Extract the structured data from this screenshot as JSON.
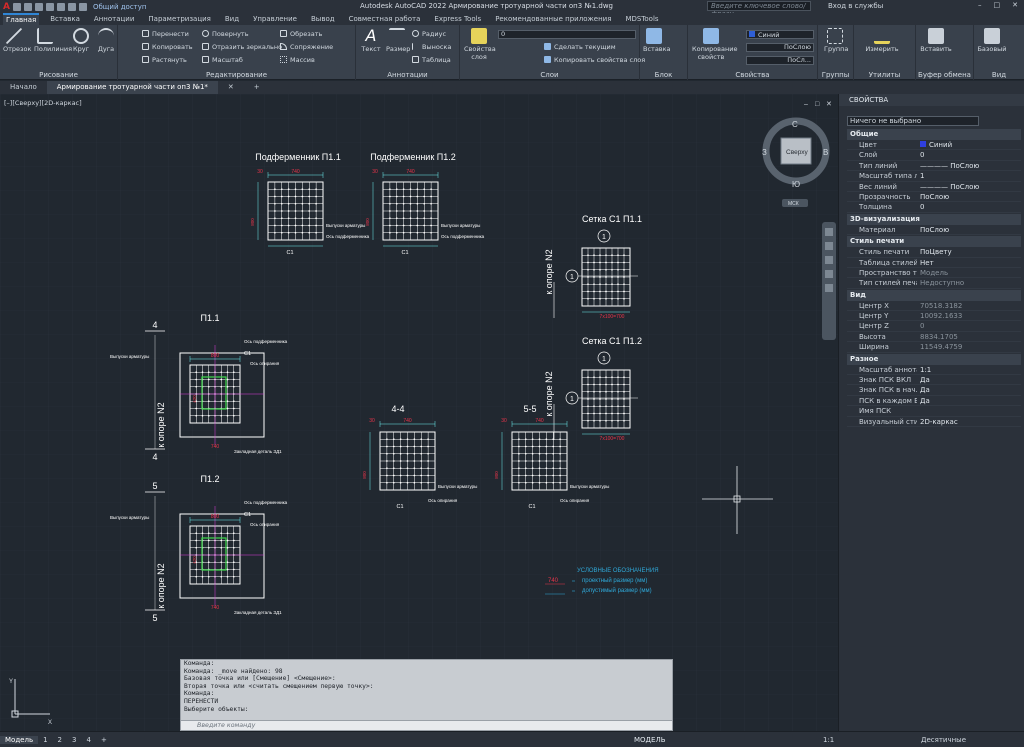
{
  "title": {
    "app_caption": "Autodesk AutoCAD 2022   Армирование тротуарной части оп3 №1.dwg",
    "share": "Общий доступ",
    "search_placeholder": "Введите ключевое слово/фразу",
    "login": "Вход в службы"
  },
  "ribbon_tabs": [
    "Главная",
    "Вставка",
    "Аннотации",
    "Параметризация",
    "Вид",
    "Управление",
    "Вывод",
    "Совместная работа",
    "Express Tools",
    "Рекомендованные приложения",
    "MDSTools"
  ],
  "ribbon": {
    "draw": {
      "title": "Рисование",
      "line": "Отрезок",
      "polyline": "Полилиния",
      "circle": "Круг",
      "arc": "Дуга"
    },
    "modify": {
      "title": "Редактирование",
      "move": "Перенести",
      "rotate": "Повернуть",
      "trim": "Обрезать",
      "copy": "Копировать",
      "mirror": "Отразить зеркально",
      "fillet": "Сопряжение",
      "stretch": "Растянуть",
      "scale": "Масштаб",
      "array": "Массив"
    },
    "annotation": {
      "title": "Аннотации",
      "text": "Текст",
      "dimension": "Размер",
      "radius": "Радиус",
      "leader": "Выноска",
      "table": "Таблица"
    },
    "layers": {
      "title": "Слои",
      "props": "Свойства слоя",
      "layer_value": "0",
      "make_current": "Сделать текущим",
      "match": "Копировать свойства слоя"
    },
    "block": {
      "title": "Блок",
      "insert": "Вставка"
    },
    "properties": {
      "title": "Свойства",
      "match": "Копирование свойств",
      "color": "Синий",
      "linetype": "ПоСлою",
      "lineweight": "ПоСл..."
    },
    "groups": {
      "title": "Группы",
      "group": "Группа"
    },
    "utilities": {
      "title": "Утилиты",
      "measure": "Измерить"
    },
    "clipboard": {
      "title": "Буфер обмена",
      "paste": "Вставить"
    },
    "view": {
      "title": "Вид",
      "base": "Базовый"
    }
  },
  "doc_tabs": {
    "start": "Начало",
    "active": "Армирование тротуарной части оп3 №1*"
  },
  "viewport_label": "[–][Сверху][2D-каркас]",
  "viewcube": {
    "top": "Сверху",
    "n": "С",
    "s": "Ю",
    "w": "З",
    "e": "В",
    "wcs": "МСК"
  },
  "drawing": {
    "titles": {
      "pf1": "Подферменник П1.1",
      "pf2": "Подферменник П1.2",
      "net1": "Сетка С1 П1.1",
      "net2": "Сетка С1 П1.2",
      "p11": "П1.1",
      "p12": "П1.2",
      "s44": "4-4",
      "s55": "5-5"
    },
    "k_opore": "к опоре N2",
    "labels": {
      "vypuski": "Выпуски арматуры",
      "os_podf": "Ось подферменника",
      "c1": "С1",
      "os_opir": "Ось опирания",
      "zakl": "Закладная деталь ЗД1",
      "mark1": "1",
      "sec4": "4",
      "sec5": "5"
    },
    "dims": {
      "d30": "30",
      "d740": "740",
      "d800": "800",
      "d740b": "7х100=700",
      "d420": "420"
    },
    "legend": {
      "title": "УСЛОВНЫЕ ОБОЗНАЧЕНИЯ",
      "line1": "проектный размер (мм)",
      "line2": "допустимый размер (мм)",
      "sample": "740"
    }
  },
  "command_lines": [
    "Команда:",
    "Команда: _move найдено: 98",
    "Базовая точка или [Смещение] <Смещение>:",
    "Вторая точка или <считать смещением первую точку>:",
    "Команда:",
    "ПЕРЕНЕСТИ",
    "Выберите объекты:"
  ],
  "command_placeholder": "Введите команду",
  "properties_panel": {
    "header": "СВОЙСТВА",
    "selection": "Ничего не выбрано",
    "cats": {
      "general": "Общие",
      "viz3d": "3D-визуализация",
      "plot": "Стиль печати",
      "view": "Вид",
      "misc": "Разное"
    },
    "general": [
      [
        "Цвет",
        "Синий"
      ],
      [
        "Слой",
        "0"
      ],
      [
        "Тип линий",
        "———— ПоСлою"
      ],
      [
        "Масштаб типа линий",
        "1"
      ],
      [
        "Вес линий",
        "———— ПоСлою"
      ],
      [
        "Прозрачность",
        "ПоСлою"
      ],
      [
        "Толщина",
        "0"
      ]
    ],
    "viz3d": [
      [
        "Материал",
        "ПоСлою"
      ]
    ],
    "plot": [
      [
        "Стиль печати",
        "ПоЦвету"
      ],
      [
        "Таблица стилей печ...",
        "Нет"
      ],
      [
        "Пространство табли...",
        "Модель"
      ],
      [
        "Тип стилей печати",
        "Недоступно"
      ]
    ],
    "view": [
      [
        "Центр X",
        "70518.3182"
      ],
      [
        "Центр Y",
        "10092.1633"
      ],
      [
        "Центр Z",
        "0"
      ],
      [
        "Высота",
        "8834.1705"
      ],
      [
        "Ширина",
        "11549.4759"
      ]
    ],
    "misc": [
      [
        "Масштаб аннотаций",
        "1:1"
      ],
      [
        "Знак ПСК ВКЛ",
        "Да"
      ],
      [
        "Знак ПСК в нач. коо...",
        "Да"
      ],
      [
        "ПСК в каждом ВЭкр...",
        "Да"
      ],
      [
        "Имя ПСК",
        ""
      ],
      [
        "Визуальный стиль",
        "2D-каркас"
      ]
    ]
  },
  "status": {
    "layouts": [
      "Модель",
      "1",
      "2",
      "3",
      "4"
    ],
    "model": "МОДЕЛЬ",
    "scale": "1:1",
    "units": "Десятичные"
  },
  "colors": {
    "accent": "#2f86d6",
    "cyan": "#6ef2f2",
    "red": "#e8344a",
    "white": "#ffffff",
    "yellow": "#e8e34a",
    "green": "#3cd84a",
    "magenta": "#e23ce2"
  }
}
